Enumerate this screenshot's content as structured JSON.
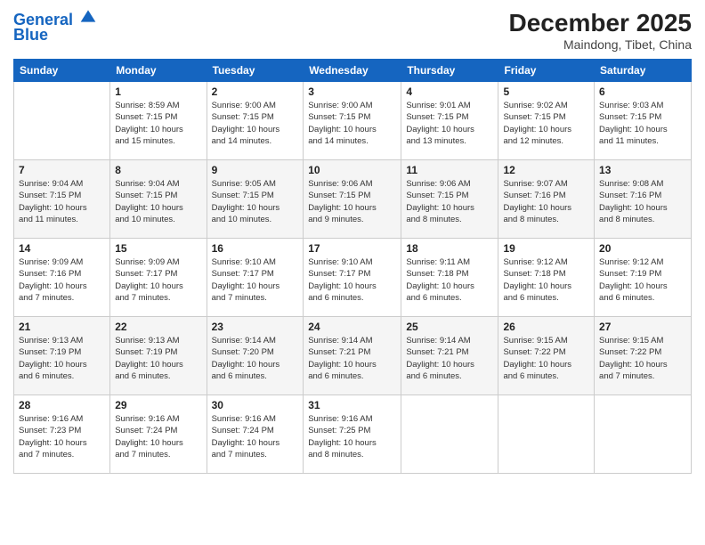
{
  "logo": {
    "line1": "General",
    "line2": "Blue"
  },
  "title": "December 2025",
  "location": "Maindong, Tibet, China",
  "days_of_week": [
    "Sunday",
    "Monday",
    "Tuesday",
    "Wednesday",
    "Thursday",
    "Friday",
    "Saturday"
  ],
  "weeks": [
    [
      {
        "day": "",
        "info": ""
      },
      {
        "day": "1",
        "info": "Sunrise: 8:59 AM\nSunset: 7:15 PM\nDaylight: 10 hours\nand 15 minutes."
      },
      {
        "day": "2",
        "info": "Sunrise: 9:00 AM\nSunset: 7:15 PM\nDaylight: 10 hours\nand 14 minutes."
      },
      {
        "day": "3",
        "info": "Sunrise: 9:00 AM\nSunset: 7:15 PM\nDaylight: 10 hours\nand 14 minutes."
      },
      {
        "day": "4",
        "info": "Sunrise: 9:01 AM\nSunset: 7:15 PM\nDaylight: 10 hours\nand 13 minutes."
      },
      {
        "day": "5",
        "info": "Sunrise: 9:02 AM\nSunset: 7:15 PM\nDaylight: 10 hours\nand 12 minutes."
      },
      {
        "day": "6",
        "info": "Sunrise: 9:03 AM\nSunset: 7:15 PM\nDaylight: 10 hours\nand 11 minutes."
      }
    ],
    [
      {
        "day": "7",
        "info": "Sunrise: 9:04 AM\nSunset: 7:15 PM\nDaylight: 10 hours\nand 11 minutes."
      },
      {
        "day": "8",
        "info": "Sunrise: 9:04 AM\nSunset: 7:15 PM\nDaylight: 10 hours\nand 10 minutes."
      },
      {
        "day": "9",
        "info": "Sunrise: 9:05 AM\nSunset: 7:15 PM\nDaylight: 10 hours\nand 10 minutes."
      },
      {
        "day": "10",
        "info": "Sunrise: 9:06 AM\nSunset: 7:15 PM\nDaylight: 10 hours\nand 9 minutes."
      },
      {
        "day": "11",
        "info": "Sunrise: 9:06 AM\nSunset: 7:15 PM\nDaylight: 10 hours\nand 8 minutes."
      },
      {
        "day": "12",
        "info": "Sunrise: 9:07 AM\nSunset: 7:16 PM\nDaylight: 10 hours\nand 8 minutes."
      },
      {
        "day": "13",
        "info": "Sunrise: 9:08 AM\nSunset: 7:16 PM\nDaylight: 10 hours\nand 8 minutes."
      }
    ],
    [
      {
        "day": "14",
        "info": "Sunrise: 9:09 AM\nSunset: 7:16 PM\nDaylight: 10 hours\nand 7 minutes."
      },
      {
        "day": "15",
        "info": "Sunrise: 9:09 AM\nSunset: 7:17 PM\nDaylight: 10 hours\nand 7 minutes."
      },
      {
        "day": "16",
        "info": "Sunrise: 9:10 AM\nSunset: 7:17 PM\nDaylight: 10 hours\nand 7 minutes."
      },
      {
        "day": "17",
        "info": "Sunrise: 9:10 AM\nSunset: 7:17 PM\nDaylight: 10 hours\nand 6 minutes."
      },
      {
        "day": "18",
        "info": "Sunrise: 9:11 AM\nSunset: 7:18 PM\nDaylight: 10 hours\nand 6 minutes."
      },
      {
        "day": "19",
        "info": "Sunrise: 9:12 AM\nSunset: 7:18 PM\nDaylight: 10 hours\nand 6 minutes."
      },
      {
        "day": "20",
        "info": "Sunrise: 9:12 AM\nSunset: 7:19 PM\nDaylight: 10 hours\nand 6 minutes."
      }
    ],
    [
      {
        "day": "21",
        "info": "Sunrise: 9:13 AM\nSunset: 7:19 PM\nDaylight: 10 hours\nand 6 minutes."
      },
      {
        "day": "22",
        "info": "Sunrise: 9:13 AM\nSunset: 7:19 PM\nDaylight: 10 hours\nand 6 minutes."
      },
      {
        "day": "23",
        "info": "Sunrise: 9:14 AM\nSunset: 7:20 PM\nDaylight: 10 hours\nand 6 minutes."
      },
      {
        "day": "24",
        "info": "Sunrise: 9:14 AM\nSunset: 7:21 PM\nDaylight: 10 hours\nand 6 minutes."
      },
      {
        "day": "25",
        "info": "Sunrise: 9:14 AM\nSunset: 7:21 PM\nDaylight: 10 hours\nand 6 minutes."
      },
      {
        "day": "26",
        "info": "Sunrise: 9:15 AM\nSunset: 7:22 PM\nDaylight: 10 hours\nand 6 minutes."
      },
      {
        "day": "27",
        "info": "Sunrise: 9:15 AM\nSunset: 7:22 PM\nDaylight: 10 hours\nand 7 minutes."
      }
    ],
    [
      {
        "day": "28",
        "info": "Sunrise: 9:16 AM\nSunset: 7:23 PM\nDaylight: 10 hours\nand 7 minutes."
      },
      {
        "day": "29",
        "info": "Sunrise: 9:16 AM\nSunset: 7:24 PM\nDaylight: 10 hours\nand 7 minutes."
      },
      {
        "day": "30",
        "info": "Sunrise: 9:16 AM\nSunset: 7:24 PM\nDaylight: 10 hours\nand 7 minutes."
      },
      {
        "day": "31",
        "info": "Sunrise: 9:16 AM\nSunset: 7:25 PM\nDaylight: 10 hours\nand 8 minutes."
      },
      {
        "day": "",
        "info": ""
      },
      {
        "day": "",
        "info": ""
      },
      {
        "day": "",
        "info": ""
      }
    ]
  ]
}
